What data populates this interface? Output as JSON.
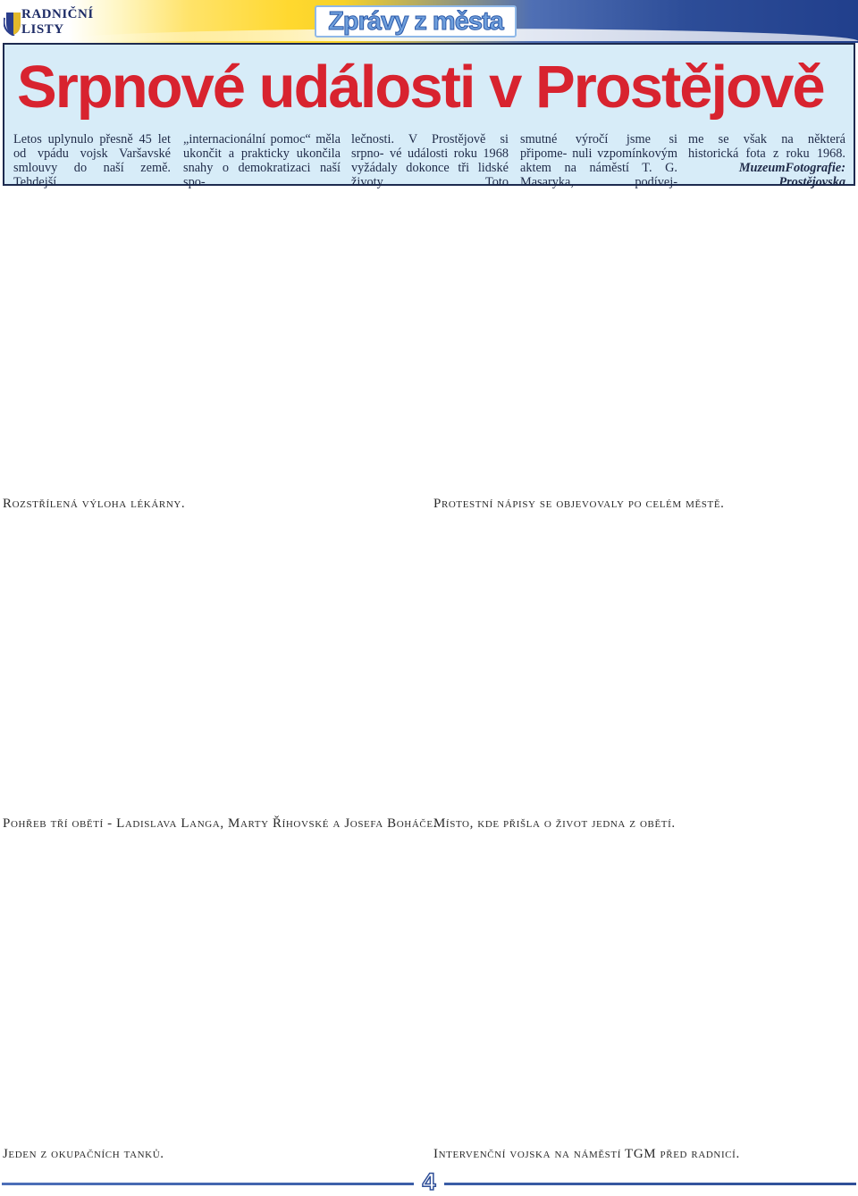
{
  "banner": {
    "logo_line1": "RADNIČNÍ",
    "logo_line2": "LISTY",
    "section_title": "Zprávy z města"
  },
  "article": {
    "headline": "Srpnové události v Prostějově",
    "columns": [
      "Letos uplynulo přesně 45 let od vpádu vojsk Varšavské smlouvy do naší země. Tehdejší",
      "„internacionální pomoc“ měla ukončit a prakticky ukončila snahy o demokratizaci naší spo-",
      "lečnosti. V Prostějově si srpno- vé události roku 1968 vyžádaly dokonce tři lidské životy. Toto",
      "smutné výročí jsme si připome- nuli vzpomínkovým aktem na náměstí T. G. Masaryka, podívej-",
      "me se však na některá historická fota z roku 1968."
    ],
    "credit_label": "Fotografie:",
    "credit_name": "Muzeum Prostějovska"
  },
  "captions": [
    "Rozstřílená výloha lékárny.",
    "Protestní nápisy se objevovaly po celém městě.",
    "Pohřeb tří obětí - Ladislava Langa, Marty Říhovské a Josefa Boháče.",
    "Místo, kde přišla o život jedna z obětí.",
    "Jeden z okupačních tanků.",
    "Intervenční vojska na náměstí TGM před radnicí."
  ],
  "page_number": "4",
  "colors": {
    "headline": "#d8232f",
    "header_background": "#d7ecf8",
    "accent_blue": "#2f4f98"
  }
}
